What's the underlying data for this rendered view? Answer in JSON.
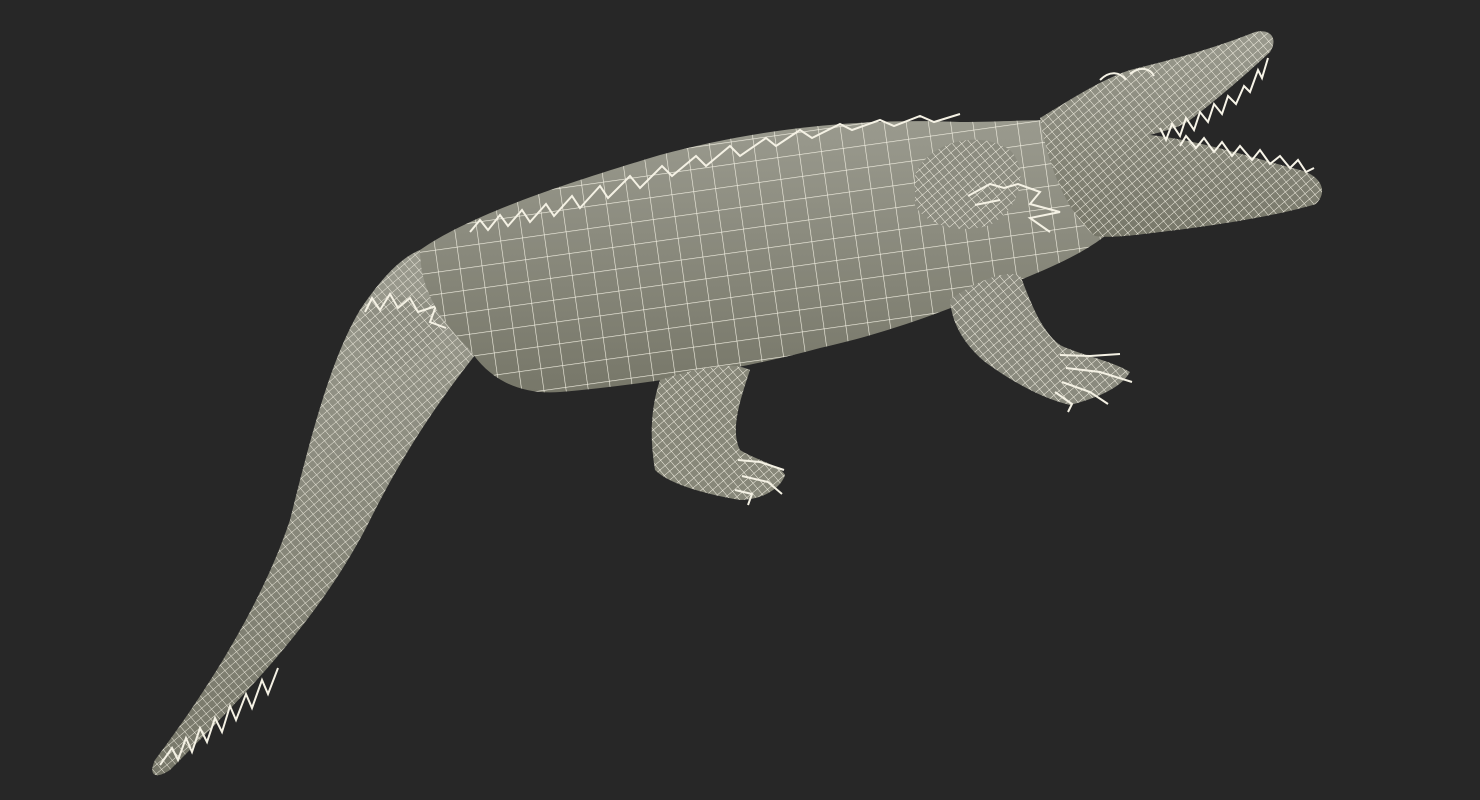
{
  "viewport": {
    "background": "#272727",
    "render_mode": "wireframe-over-shaded",
    "subject": "crocodile-3d-model"
  },
  "model": {
    "surface_color": "#8a8a7e",
    "surface_shadow_color": "#6e6e63",
    "wire_color": "#f4f1e4",
    "teeth_color": "#f7f4e8"
  }
}
